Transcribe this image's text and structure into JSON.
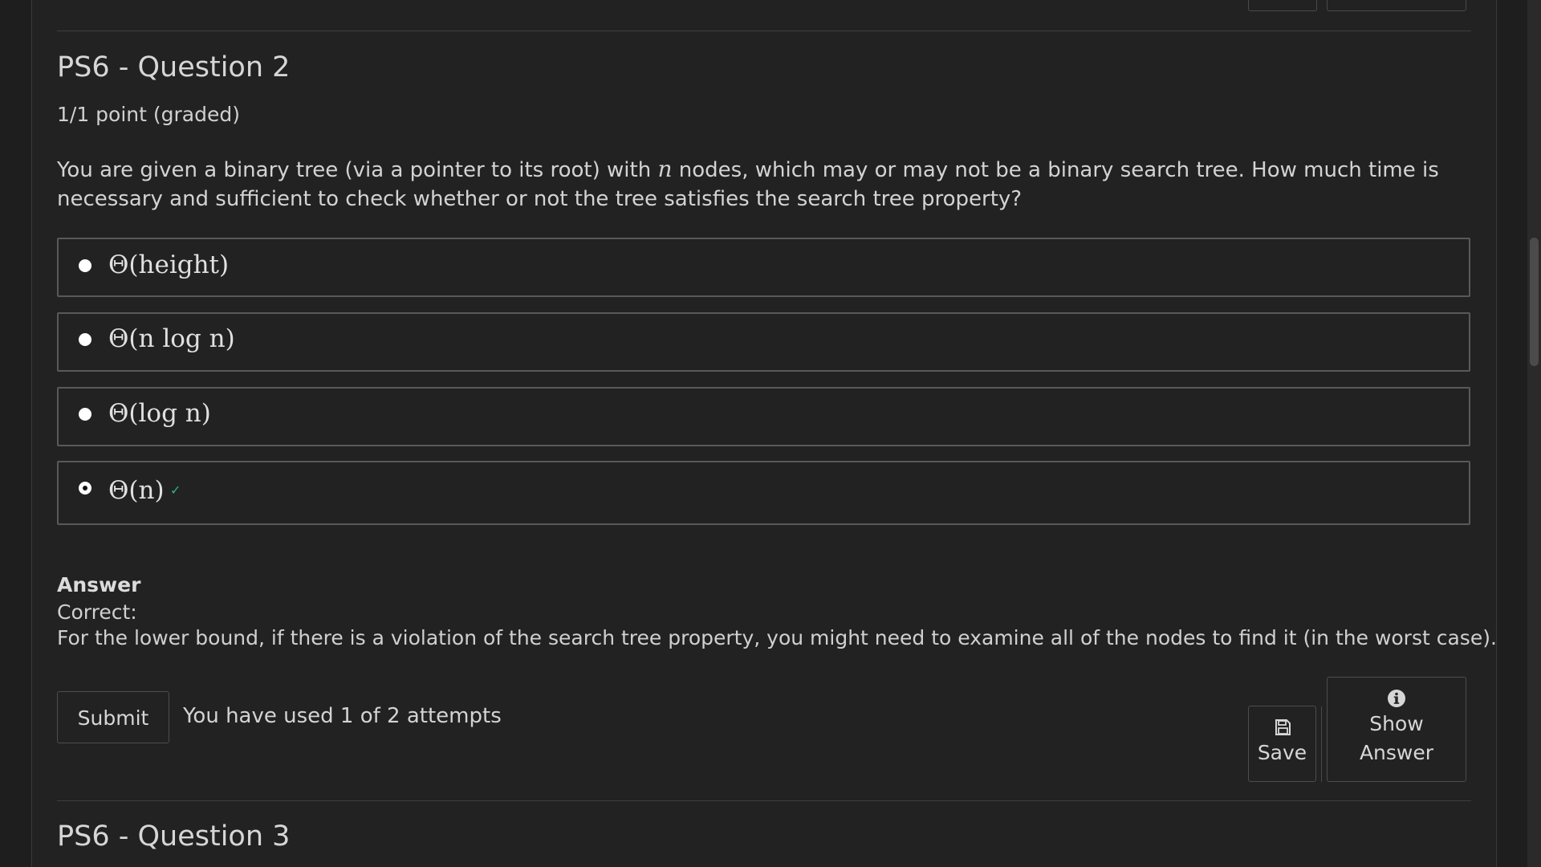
{
  "question2": {
    "title": "PS6 - Question 2",
    "points": "1/1 point (graded)",
    "prompt_part1": "You are given a binary tree (via a pointer to its root) with ",
    "prompt_var": "n",
    "prompt_part2": " nodes, which may or may not be a binary search tree. How much time is necessary and sufficient to check whether or not the tree satisfies the search tree property?",
    "choices": [
      {
        "label": "Θ(height)",
        "selected": false
      },
      {
        "label": "Θ(n log n)",
        "selected": false
      },
      {
        "label": "Θ(log n)",
        "selected": false
      },
      {
        "label": "Θ(n)",
        "selected": true
      }
    ],
    "correct_mark_icon": "correct-check-icon"
  },
  "answer": {
    "heading": "Answer",
    "status": "Correct:",
    "explanation": "For the lower bound, if there is a violation of the search tree property, you might need to examine all of the nodes to find it (in the worst case)."
  },
  "actions": {
    "submit_label": "Submit",
    "attempts_text": "You have used 1 of 2 attempts",
    "save_label": "Save",
    "save_icon": "floppy-disk-icon",
    "show_answer_line1": "Show",
    "show_answer_line2": "Answer",
    "show_answer_icon": "info-circle-icon"
  },
  "question3": {
    "title": "PS6 - Question 3"
  },
  "colors": {
    "background": "#222222",
    "text": "#d4d4d4",
    "correct_accent": "#2bb38a",
    "border": "#595959"
  }
}
